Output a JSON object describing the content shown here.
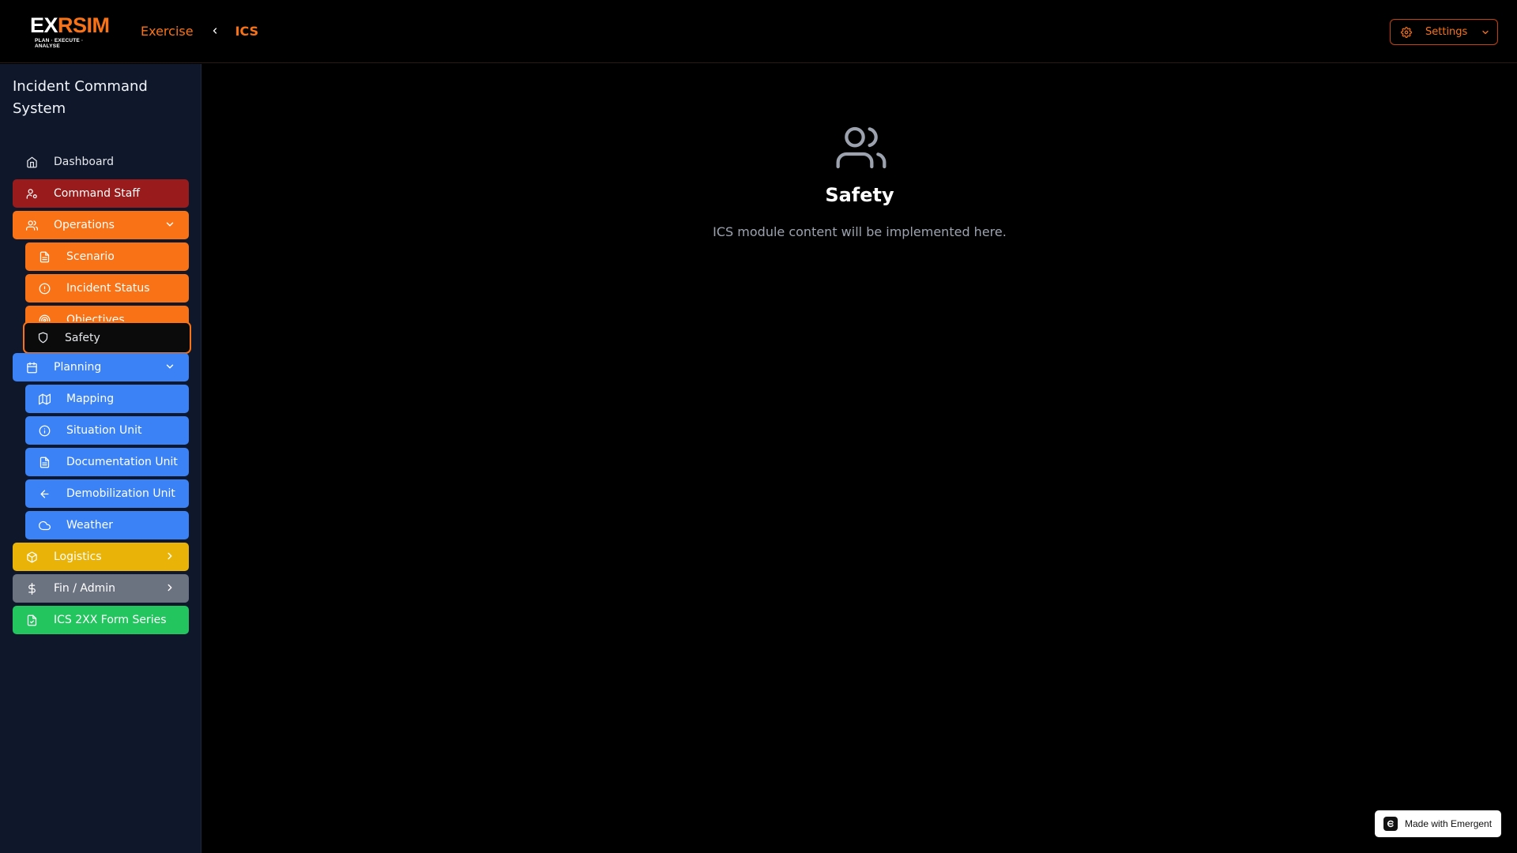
{
  "header": {
    "logo_part1": "EX",
    "logo_part2": "R",
    "logo_part3": "SIM",
    "logo_tagline": "PLAN · EXECUTE · ANALYSE",
    "breadcrumb_parent": "Exercise",
    "breadcrumb_current": "ICS",
    "settings_label": "Settings"
  },
  "sidebar": {
    "title": "Incident Command System",
    "items": [
      {
        "label": "Dashboard",
        "icon": "home-icon"
      },
      {
        "label": "Command Staff",
        "icon": "user-cog-icon"
      },
      {
        "label": "Operations",
        "icon": "users-icon",
        "expanded": true
      },
      {
        "label": "Scenario",
        "icon": "file-text-icon"
      },
      {
        "label": "Incident Status",
        "icon": "alert-circle-icon"
      },
      {
        "label": "Objectives",
        "icon": "target-icon"
      },
      {
        "label": "Safety",
        "icon": "shield-icon",
        "active": true
      },
      {
        "label": "Planning",
        "icon": "calendar-icon",
        "expanded": true
      },
      {
        "label": "Mapping",
        "icon": "map-icon"
      },
      {
        "label": "Situation Unit",
        "icon": "info-icon"
      },
      {
        "label": "Documentation Unit",
        "icon": "file-text-icon"
      },
      {
        "label": "Demobilization Unit",
        "icon": "arrow-left-icon"
      },
      {
        "label": "Weather",
        "icon": "cloud-icon"
      },
      {
        "label": "Logistics",
        "icon": "package-icon",
        "expanded": false
      },
      {
        "label": "Fin / Admin",
        "icon": "dollar-icon",
        "expanded": false
      },
      {
        "label": "ICS 2XX Form Series",
        "icon": "file-icon"
      }
    ]
  },
  "main": {
    "title": "Safety",
    "description": "ICS module content will be implemented here.",
    "icon": "users-icon"
  },
  "badge": {
    "label": "Made with Emergent"
  },
  "colors": {
    "accent": "#f97316",
    "command_staff": "#991b1b",
    "operations": "#f97316",
    "planning": "#3b82f6",
    "logistics": "#eab308",
    "fin_admin": "#6b7280",
    "forms": "#22c55e",
    "sidebar_bg": "#0f172a"
  }
}
